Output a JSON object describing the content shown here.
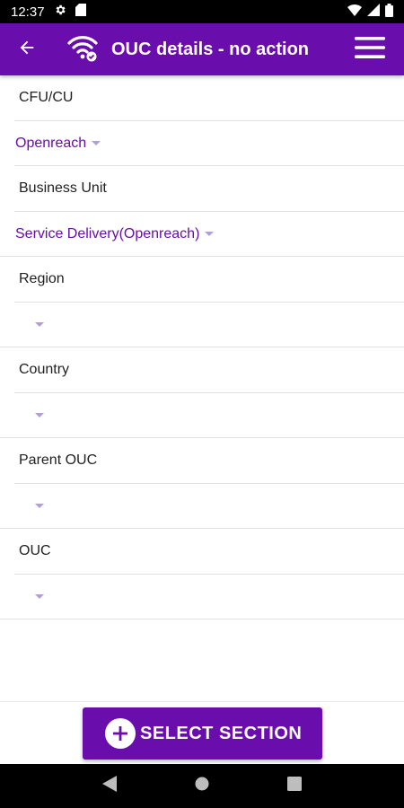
{
  "status_bar": {
    "time": "12:37",
    "icons": [
      "settings-icon",
      "sd-card-icon",
      "wifi-icon",
      "signal-icon",
      "battery-icon"
    ]
  },
  "app_bar": {
    "title": "OUC details - no action",
    "background_color": "#6a0dad",
    "icons": [
      "back-arrow-icon",
      "wifi-check-icon",
      "hamburger-menu-icon"
    ]
  },
  "form": {
    "cfu": {
      "label": "CFU/CU",
      "value": "Openreach"
    },
    "business_unit": {
      "label": "Business Unit",
      "value": "Service Delivery(Openreach)"
    },
    "region": {
      "label": "Region",
      "value": ""
    },
    "country": {
      "label": "Country",
      "value": ""
    },
    "parent_ouc": {
      "label": "Parent OUC",
      "value": ""
    },
    "ouc": {
      "label": "OUC",
      "value": ""
    }
  },
  "footer": {
    "button_label": "SELECT SECTION",
    "button_icon": "plus-circle-icon",
    "accent_color": "#6a0dad"
  },
  "nav_bar": {
    "icons": [
      "nav-back-icon",
      "nav-home-icon",
      "nav-recents-icon"
    ]
  }
}
